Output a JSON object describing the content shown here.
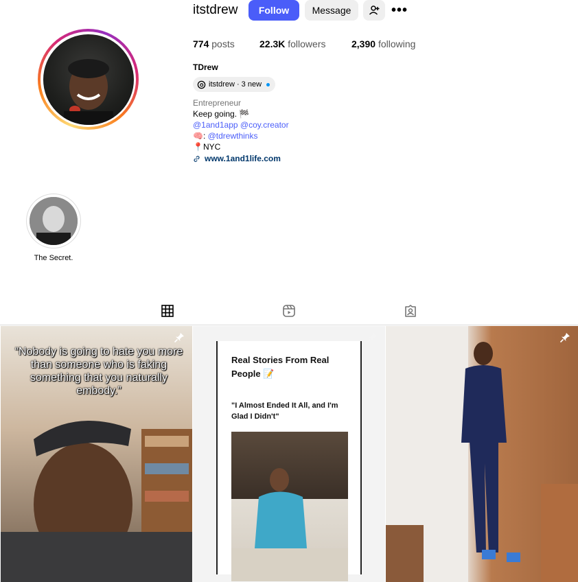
{
  "header": {
    "username": "itstdrew",
    "follow_label": "Follow",
    "message_label": "Message",
    "more_label": "•••"
  },
  "stats": {
    "posts_count": "774",
    "posts_label": "posts",
    "followers_count": "22.3K",
    "followers_label": "followers",
    "following_count": "2,390",
    "following_label": "following"
  },
  "bio": {
    "name": "TDrew",
    "threads_handle": "itstdrew · 3 new",
    "category": "Entrepreneur",
    "line1": "Keep going. 🏁",
    "mention1": "@1and1app",
    "mention2": "@coy.creator",
    "thinks_prefix": "🧠: ",
    "mention3": "@tdrewthinks",
    "location": "📍NYC",
    "website": "www.1and1life.com"
  },
  "highlights": [
    {
      "label": "The Secret."
    }
  ],
  "tabs": [
    {
      "name": "posts",
      "icon": "grid-icon",
      "active": true
    },
    {
      "name": "reels",
      "icon": "reels-icon",
      "active": false
    },
    {
      "name": "tagged",
      "icon": "tagged-icon",
      "active": false
    }
  ],
  "posts": [
    {
      "quote": "“Nobody is going to hate you more than someone who is faking something that you naturally embody.”",
      "pinned": true
    },
    {
      "title": "Real Stories From Real People 📝",
      "subtitle": "\"I Almost Ended It All, and I'm Glad I Didn't\"",
      "pinned": true
    },
    {
      "pinned": true
    }
  ],
  "colors": {
    "follow_button": "#4a5df9",
    "link": "#4a5df9",
    "url": "#00376b",
    "secondary_button": "#efefef"
  }
}
